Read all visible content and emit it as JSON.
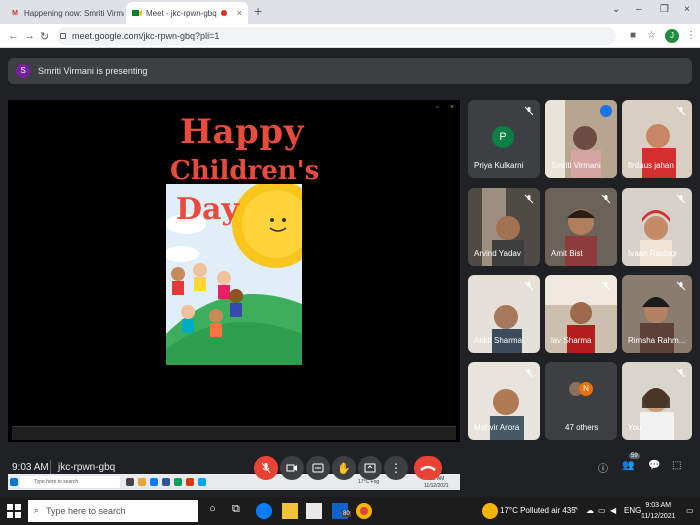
{
  "browser": {
    "tabs": [
      {
        "label": "Happening now: Smriti Virmani is",
        "favicon": "gmail-icon"
      },
      {
        "label": "Meet - jkc-rpwn-gbq",
        "favicon": "meet-icon",
        "recording": true
      }
    ],
    "url": "meet.google.com/jkc-rpwn-gbq?pli=1",
    "profile_initial": "J"
  },
  "presenting": {
    "avatar_initial": "S",
    "text": "Smriti Virmani is presenting"
  },
  "presentation": {
    "line1": "Happy",
    "line2": "Children's",
    "line3": "Day",
    "mini_taskbar_search": "Type here to search",
    "mini_weather": "17°C Fog",
    "mini_time": "9:02 AM",
    "mini_date": "11/12/2021"
  },
  "participants": [
    {
      "name": "Priya Kulkarni",
      "initial": "P",
      "muted": true
    },
    {
      "name": "Smriti Virmani",
      "speaking": true
    },
    {
      "name": "firdaus jahan",
      "muted": true
    },
    {
      "name": "Arvind Yadav",
      "muted": true
    },
    {
      "name": "Amit Bist",
      "muted": true
    },
    {
      "name": "Ivaan Rastogi",
      "muted": true
    },
    {
      "name": "Ankit Sharma",
      "muted": true
    },
    {
      "name": "lav Sharma",
      "muted": true
    },
    {
      "name": "Rimsha Rahm...",
      "muted": true
    },
    {
      "name": "Mahvir Arora",
      "muted": true
    },
    {
      "name": "47 others",
      "initial": "N"
    },
    {
      "name": "You",
      "muted": true
    }
  ],
  "controls": {
    "time": "9:03 AM",
    "meeting_code": "jkc-rpwn-gbq",
    "people_count": "59"
  },
  "taskbar": {
    "search_placeholder": "Type here to search",
    "weather": "17°C  Polluted air 435",
    "language": "ENG",
    "time": "9:03 AM",
    "date": "11/12/2021",
    "mail_badge": "80"
  },
  "colors": {
    "meet_bg": "#202124",
    "tile_bg": "#3c4043",
    "danger": "#ea4335",
    "title_red": "#e74c3c",
    "speaking_outline": "#8ab4f8"
  }
}
